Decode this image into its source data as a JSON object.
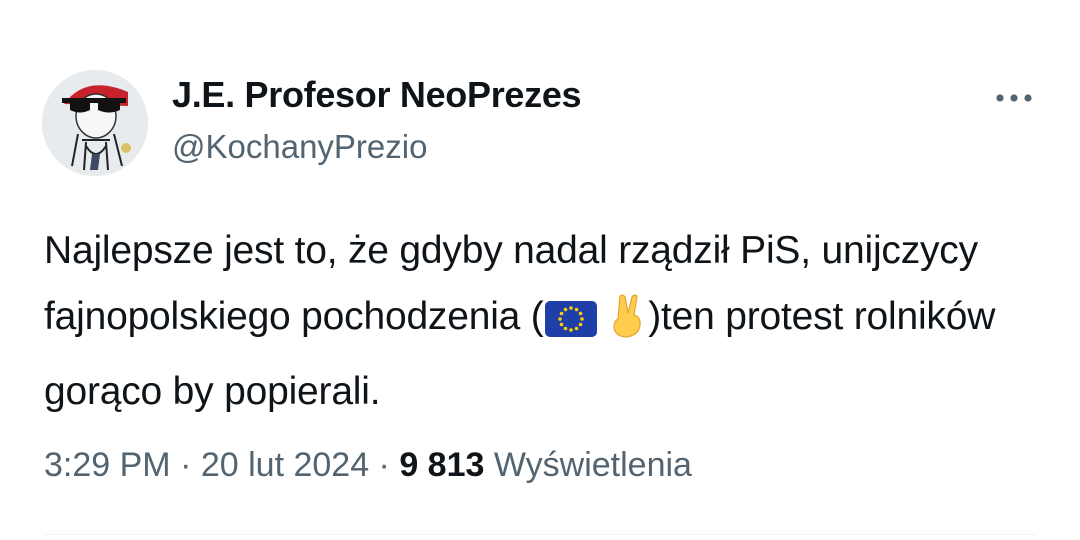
{
  "author": {
    "display_name": "J.E. Profesor NeoPrezes",
    "handle": "@KochanyPrezio"
  },
  "icons": {
    "more": "more-horizontal-icon",
    "flag": "eu-flag-icon",
    "victory": "victory-hand-icon"
  },
  "tweet": {
    "text_part1": "Najlepsze jest to, że gdyby nadal rządził PiS, unijczycy fajnopolskiego pochodzenia (",
    "text_part2": ")ten protest rolników gorąco by popierali."
  },
  "meta": {
    "time": "3:29 PM",
    "sep1": " · ",
    "date": "20 lut 2024",
    "sep2": " · ",
    "views_count": "9 813",
    "views_label": " Wyświetlenia"
  },
  "colors": {
    "text": "#0f1419",
    "secondary": "#536471",
    "eu_blue": "#003399",
    "eu_star": "#ffcc00"
  }
}
